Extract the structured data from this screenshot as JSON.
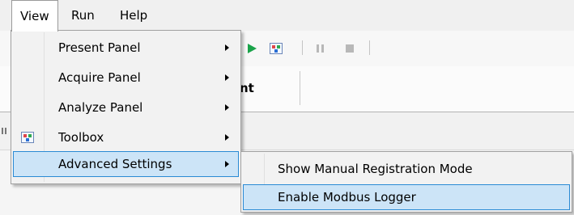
{
  "menubar": {
    "items": [
      {
        "label": "View"
      },
      {
        "label": "Run"
      },
      {
        "label": "Help"
      }
    ]
  },
  "ribbon": {
    "partial_label": "nt"
  },
  "view_menu": {
    "items": [
      {
        "label": "Present Panel",
        "has_submenu": true
      },
      {
        "label": "Acquire Panel",
        "has_submenu": true
      },
      {
        "label": "Analyze Panel",
        "has_submenu": true
      },
      {
        "label": "Toolbox",
        "has_submenu": true,
        "icon": "toolbox-icon"
      },
      {
        "label": "Advanced Settings",
        "has_submenu": true,
        "highlighted": true
      }
    ]
  },
  "advanced_submenu": {
    "items": [
      {
        "label": "Show Manual Registration Mode"
      },
      {
        "label": "Enable Modbus Logger",
        "highlighted": true
      }
    ]
  },
  "colors": {
    "highlight_bg": "#cce4f7",
    "highlight_border": "#2a8ad4",
    "play_green": "#1aa34a"
  },
  "toolbar": {
    "icons": [
      "play-icon",
      "image-icon",
      "pause-icon",
      "stop-icon"
    ]
  }
}
